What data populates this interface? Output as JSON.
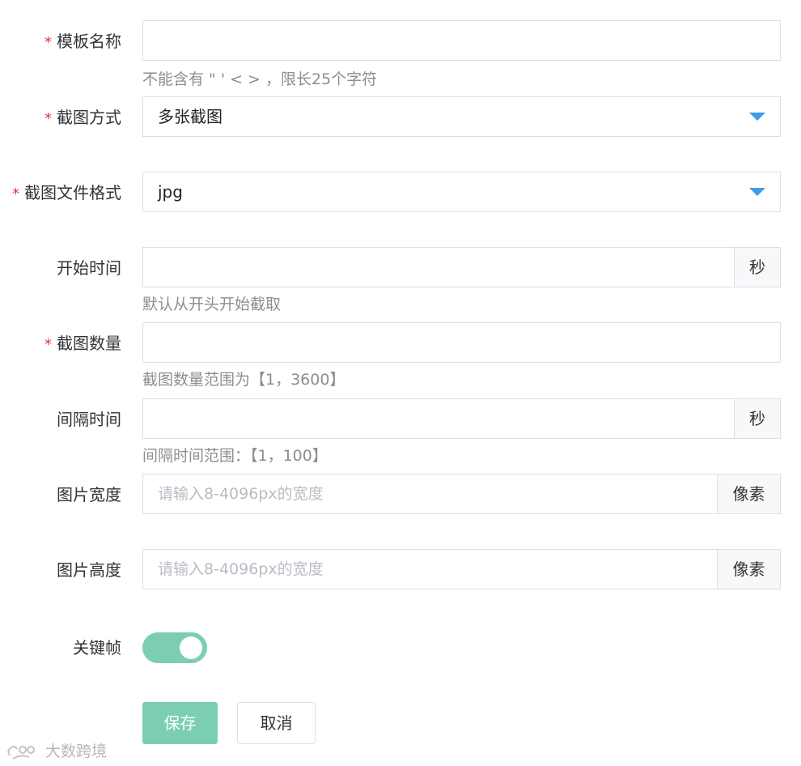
{
  "form": {
    "template_name": {
      "label": "模板名称",
      "required": true,
      "value": "",
      "hint": "不能含有 \" ' < > ，限长25个字符"
    },
    "capture_mode": {
      "label": "截图方式",
      "required": true,
      "value": "多张截图"
    },
    "file_format": {
      "label": "截图文件格式",
      "required": true,
      "value": "jpg"
    },
    "start_time": {
      "label": "开始时间",
      "required": false,
      "value": "",
      "suffix": "秒",
      "hint": "默认从开头开始截取"
    },
    "capture_count": {
      "label": "截图数量",
      "required": true,
      "value": "",
      "hint": "截图数量范围为【1，3600】"
    },
    "interval": {
      "label": "间隔时间",
      "required": false,
      "value": "",
      "suffix": "秒",
      "hint": "间隔时间范围：【1，100】"
    },
    "width": {
      "label": "图片宽度",
      "required": false,
      "value": "",
      "placeholder": "请输入8-4096px的宽度",
      "suffix": "像素"
    },
    "height": {
      "label": "图片高度",
      "required": false,
      "value": "",
      "placeholder": "请输入8-4096px的宽度",
      "suffix": "像素"
    },
    "keyframe": {
      "label": "关键帧",
      "enabled": true
    },
    "required_mark": "*"
  },
  "actions": {
    "save_label": "保存",
    "cancel_label": "取消"
  },
  "watermark": {
    "text": "大数跨境"
  },
  "colors": {
    "accent": "#7bcfb0",
    "required": "#e2353a",
    "caret": "#3d9be9",
    "border": "#dcdfe6"
  }
}
